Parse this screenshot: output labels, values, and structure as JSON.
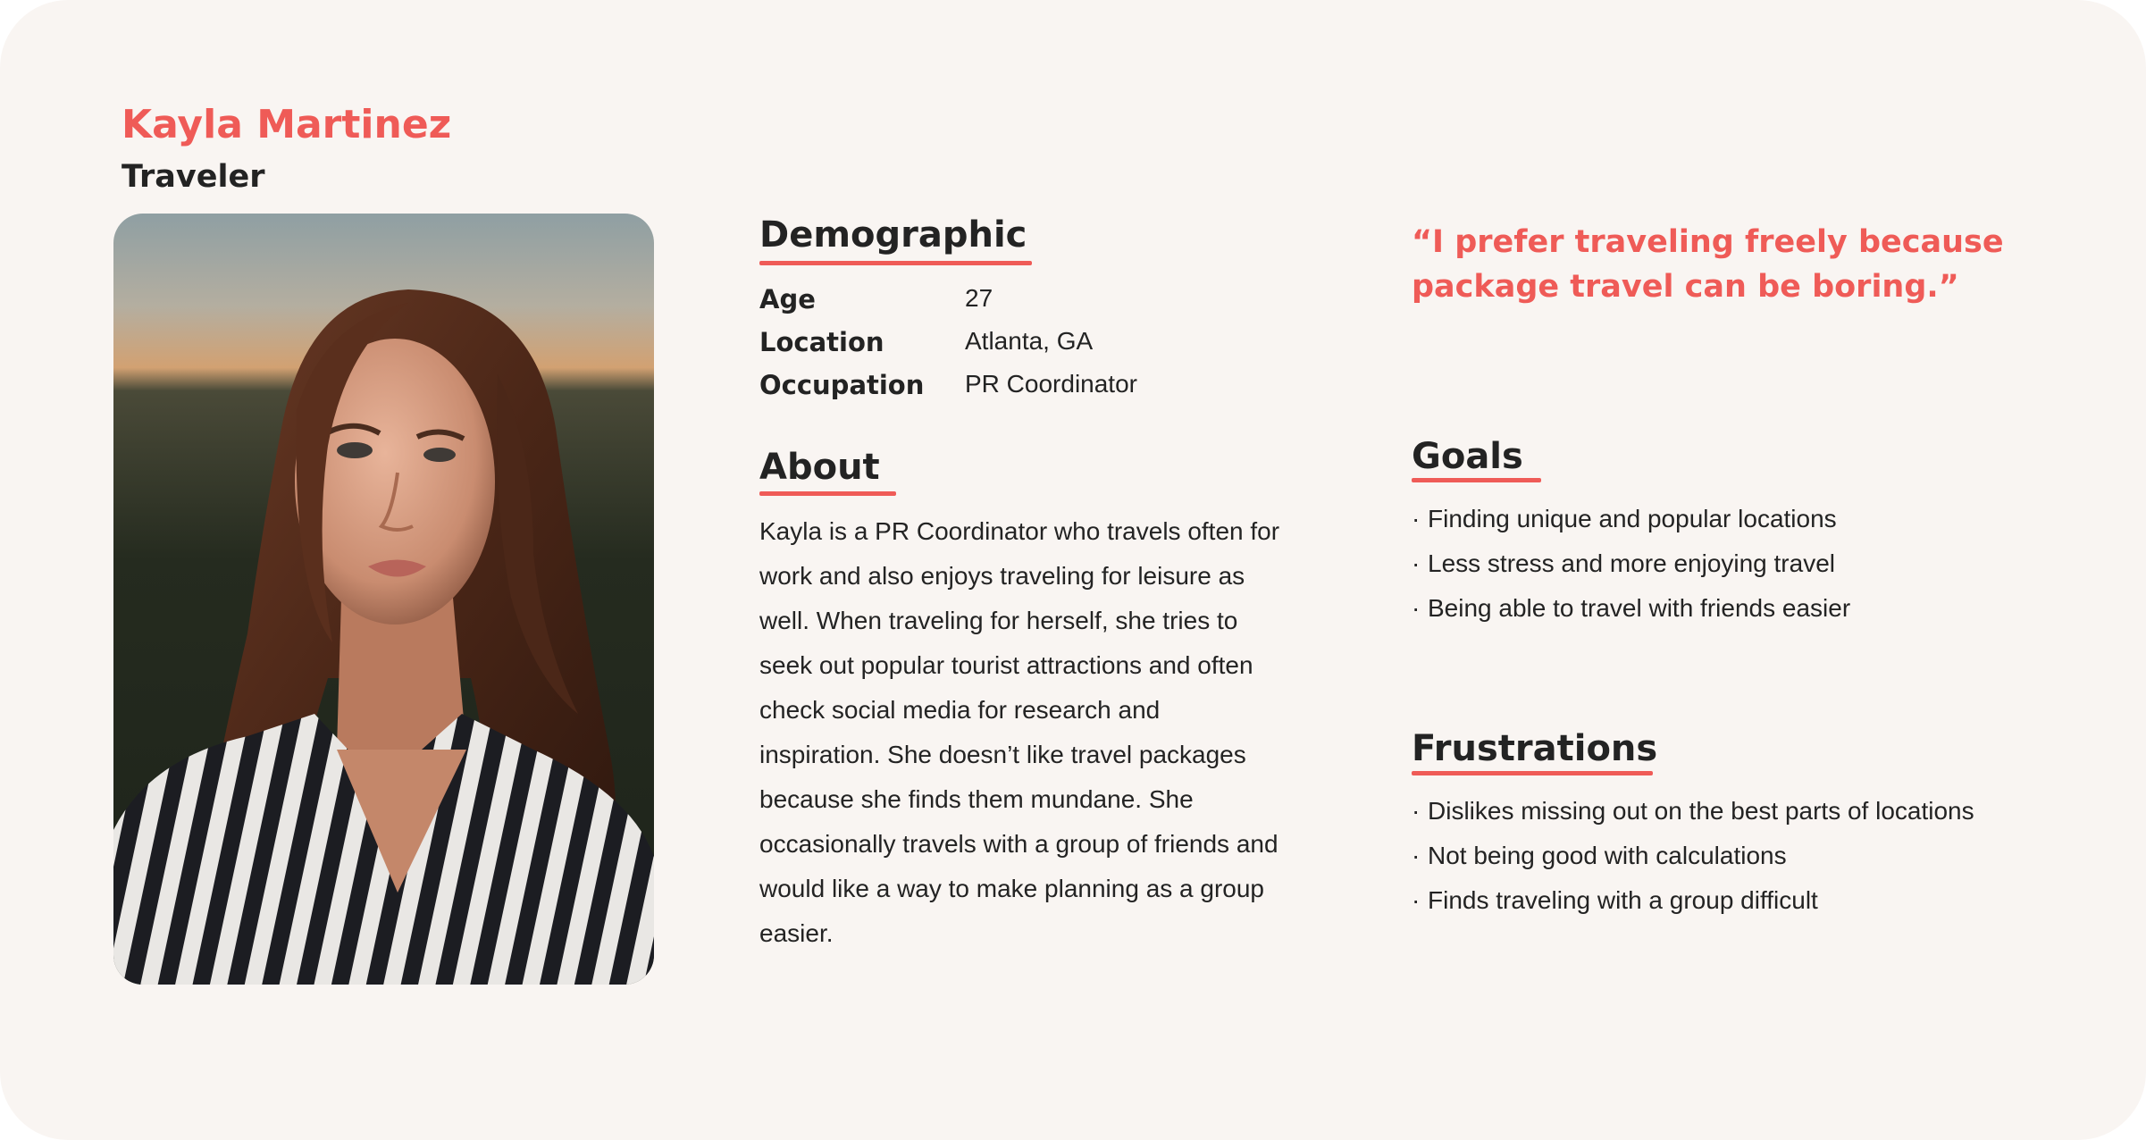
{
  "persona": {
    "name": "Kayla Martinez",
    "role": "Traveler",
    "photo_icon": "portrait-photo",
    "accent_color": "#ef5b57",
    "background_color": "#f9f5f2",
    "text_color": "#232323"
  },
  "demographic": {
    "heading": "Demographic",
    "rows": [
      {
        "label": "Age",
        "value": "27"
      },
      {
        "label": "Location",
        "value": "Atlanta, GA"
      },
      {
        "label": "Occupation",
        "value": "PR Coordinator"
      }
    ]
  },
  "about": {
    "heading": "About",
    "lines": [
      "Kayla is a PR Coordinator who travels often for",
      "work and also enjoys traveling for leisure as",
      "well. When traveling for herself, she tries to",
      "seek out popular tourist attractions and often",
      "check social media for research and",
      "inspiration. She doesn’t like travel packages",
      "because she finds them mundane. She",
      "occasionally travels with a group of friends and",
      "would like a way to make planning as a group",
      "easier."
    ]
  },
  "quote": {
    "lines": [
      "“I prefer traveling freely because",
      "package travel can be boring.”"
    ]
  },
  "goals": {
    "heading": "Goals",
    "bullet": "·",
    "items": [
      "Finding unique and popular locations",
      "Less stress and more enjoying travel",
      "Being able to travel with friends easier"
    ]
  },
  "frustrations": {
    "heading": "Frustrations",
    "bullet": "·",
    "items": [
      "Dislikes missing out on the best parts of locations",
      "Not being good with calculations",
      "Finds traveling with a group difficult"
    ]
  }
}
